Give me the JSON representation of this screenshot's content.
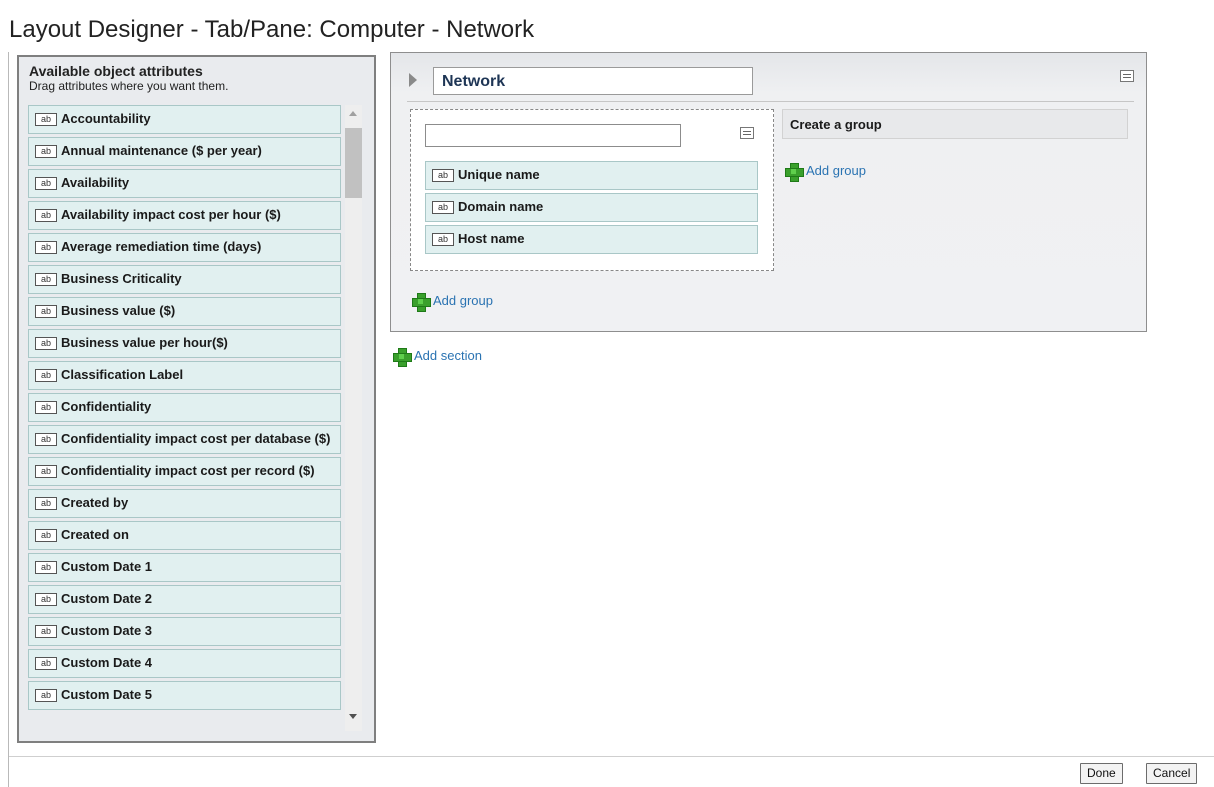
{
  "page": {
    "title": "Layout Designer - Tab/Pane: Computer - Network"
  },
  "palette": {
    "heading": "Available object attributes",
    "subheading": "Drag attributes where you want them.",
    "type_badge": "ab",
    "items": [
      "Accountability",
      "Annual maintenance ($ per year)",
      "Availability",
      "Availability impact cost per hour ($)",
      "Average remediation time (days)",
      "Business Criticality",
      "Business value ($)",
      "Business value per hour($)",
      "Classification Label",
      "Confidentiality",
      "Confidentiality impact cost per database ($)",
      "Confidentiality impact cost per record ($)",
      "Created by",
      "Created on",
      "Custom Date 1",
      "Custom Date 2",
      "Custom Date 3",
      "Custom Date 4",
      "Custom Date 5"
    ]
  },
  "section": {
    "name": "Network",
    "group": {
      "name": "",
      "attributes": [
        "Unique name",
        "Domain name",
        "Host name"
      ],
      "add_group_label": "Add group"
    },
    "create_group_label": "Create a group",
    "add_group_label": "Add group"
  },
  "add_section_label": "Add section",
  "buttons": {
    "done": "Done",
    "cancel": "Cancel"
  }
}
